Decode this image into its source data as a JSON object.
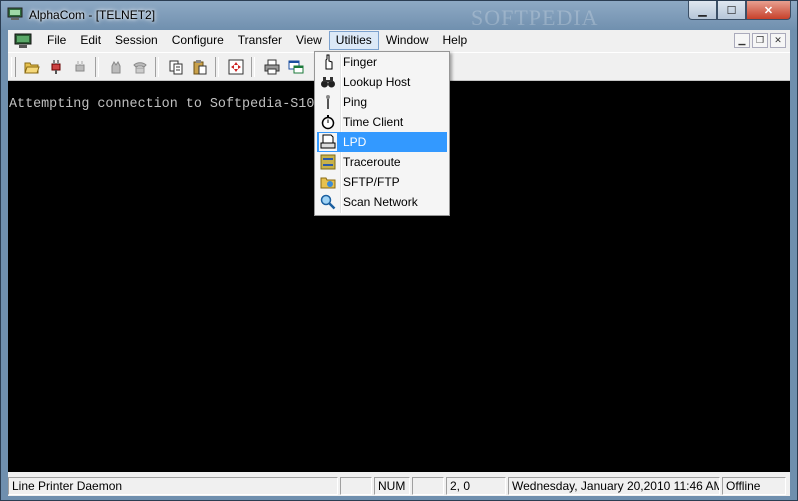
{
  "window": {
    "title": "AlphaCom - [TELNET2]",
    "watermark": "SOFTPEDIA",
    "controls": [
      "minimize",
      "maximize",
      "close"
    ]
  },
  "menubar": {
    "items": [
      "File",
      "Edit",
      "Session",
      "Configure",
      "Transfer",
      "View",
      "Utilties",
      "Window",
      "Help"
    ],
    "active": "Utilties"
  },
  "toolbar": {
    "buttons": [
      "open-folder",
      "connect",
      "disconnect",
      "hangup",
      "phone",
      "copy",
      "paste",
      "capture",
      "print",
      "options"
    ]
  },
  "terminal": {
    "text": "Attempting connection to Softpedia-S10",
    "background": "#000000",
    "foreground": "#c0c0c0"
  },
  "utilities_menu": {
    "items": [
      {
        "label": "Finger",
        "icon": "finger-icon"
      },
      {
        "label": "Lookup Host",
        "icon": "binoculars-icon"
      },
      {
        "label": "Ping",
        "icon": "ping-icon"
      },
      {
        "label": "Time Client",
        "icon": "stopwatch-icon"
      },
      {
        "label": "LPD",
        "icon": "printer-icon",
        "highlighted": true
      },
      {
        "label": "Traceroute",
        "icon": "traceroute-icon"
      },
      {
        "label": "SFTP/FTP",
        "icon": "ftp-folder-icon"
      },
      {
        "label": "Scan Network",
        "icon": "magnifier-icon"
      }
    ]
  },
  "statusbar": {
    "message": "Line Printer Daemon",
    "num": "NUM",
    "cursor": "2, 0",
    "datetime": "Wednesday, January 20,2010 11:46 AM",
    "state": "Offline"
  },
  "colors": {
    "highlight": "#3399ff",
    "menu_active_bg": "#dce9f7"
  }
}
